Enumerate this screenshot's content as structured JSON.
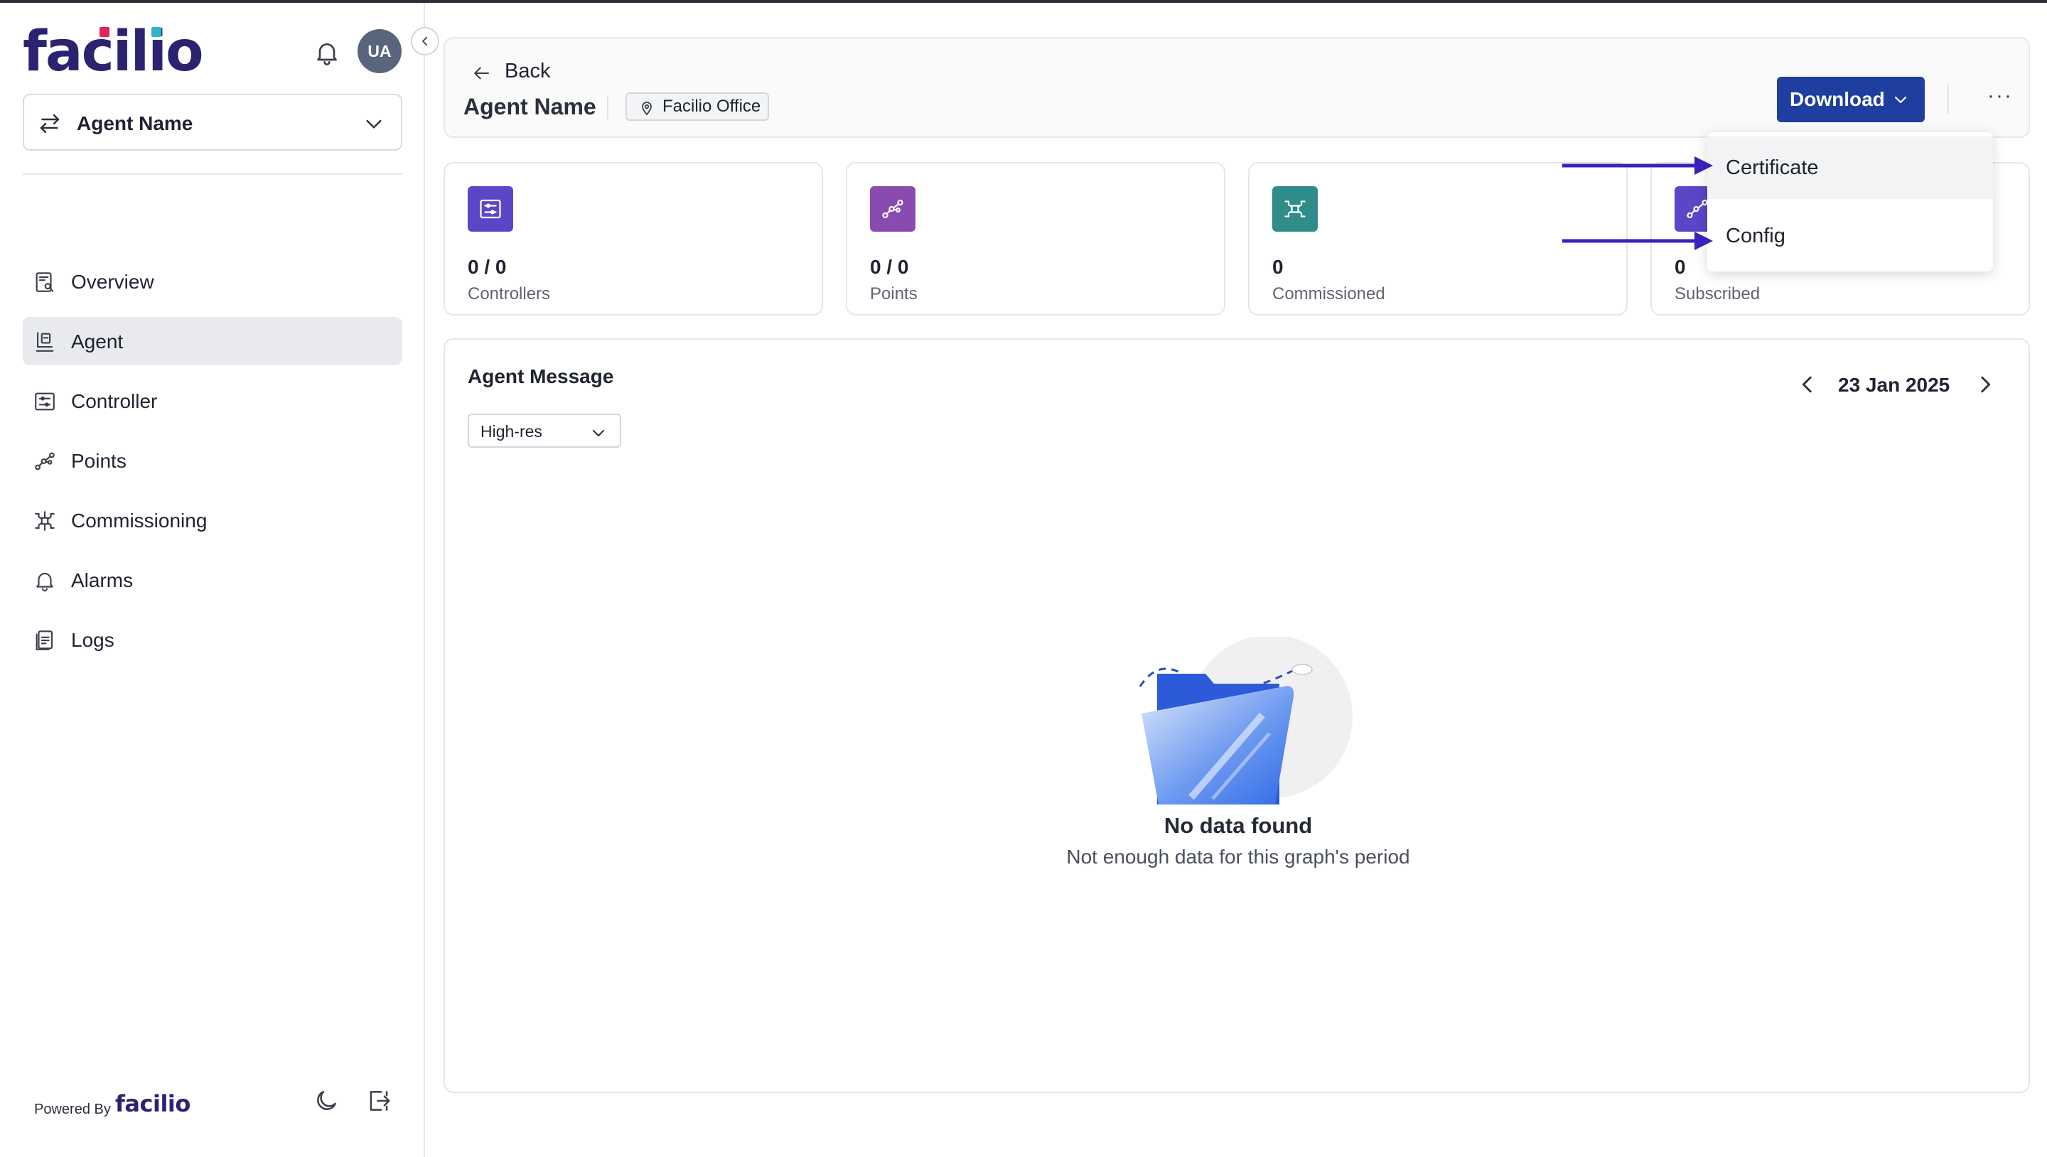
{
  "brand": {
    "logo_text": "facilio",
    "accent_color": "#2b2370"
  },
  "topbar": {
    "avatar_initials": "UA"
  },
  "sidebar": {
    "agent_selector": "Agent Name",
    "items": [
      {
        "label": "Overview",
        "icon": "overview-icon"
      },
      {
        "label": "Agent",
        "icon": "agent-icon",
        "active": true
      },
      {
        "label": "Controller",
        "icon": "controller-icon"
      },
      {
        "label": "Points",
        "icon": "points-icon"
      },
      {
        "label": "Commissioning",
        "icon": "commissioning-icon"
      },
      {
        "label": "Alarms",
        "icon": "bell-icon"
      },
      {
        "label": "Logs",
        "icon": "logs-icon"
      }
    ],
    "footer": {
      "powered_by": "Powered By",
      "brand": "facilio"
    }
  },
  "header": {
    "back_label": "Back",
    "title": "Agent Name",
    "location": "Facilio Office",
    "download_label": "Download",
    "more_label": "···"
  },
  "stats": [
    {
      "value": "0 / 0",
      "label": "Controllers",
      "color": "#5b46c8",
      "icon": "controller-icon"
    },
    {
      "value": "0 / 0",
      "label": "Points",
      "color": "#8a4bb0",
      "icon": "points-icon"
    },
    {
      "value": "0",
      "label": "Commissioned",
      "color": "#2f8c8a",
      "icon": "commissioning-icon"
    },
    {
      "value": "0",
      "label": "Subscribed",
      "color": "#5b46c8",
      "icon": "points-icon"
    }
  ],
  "chart": {
    "title": "Agent Message",
    "resolution": "High-res",
    "date": "23 Jan 2025",
    "empty_title": "No data found",
    "empty_subtitle": "Not enough data for this graph's period"
  },
  "download_menu": {
    "items": [
      "Certificate",
      "Config"
    ],
    "annotation_color": "#3a22b8"
  }
}
